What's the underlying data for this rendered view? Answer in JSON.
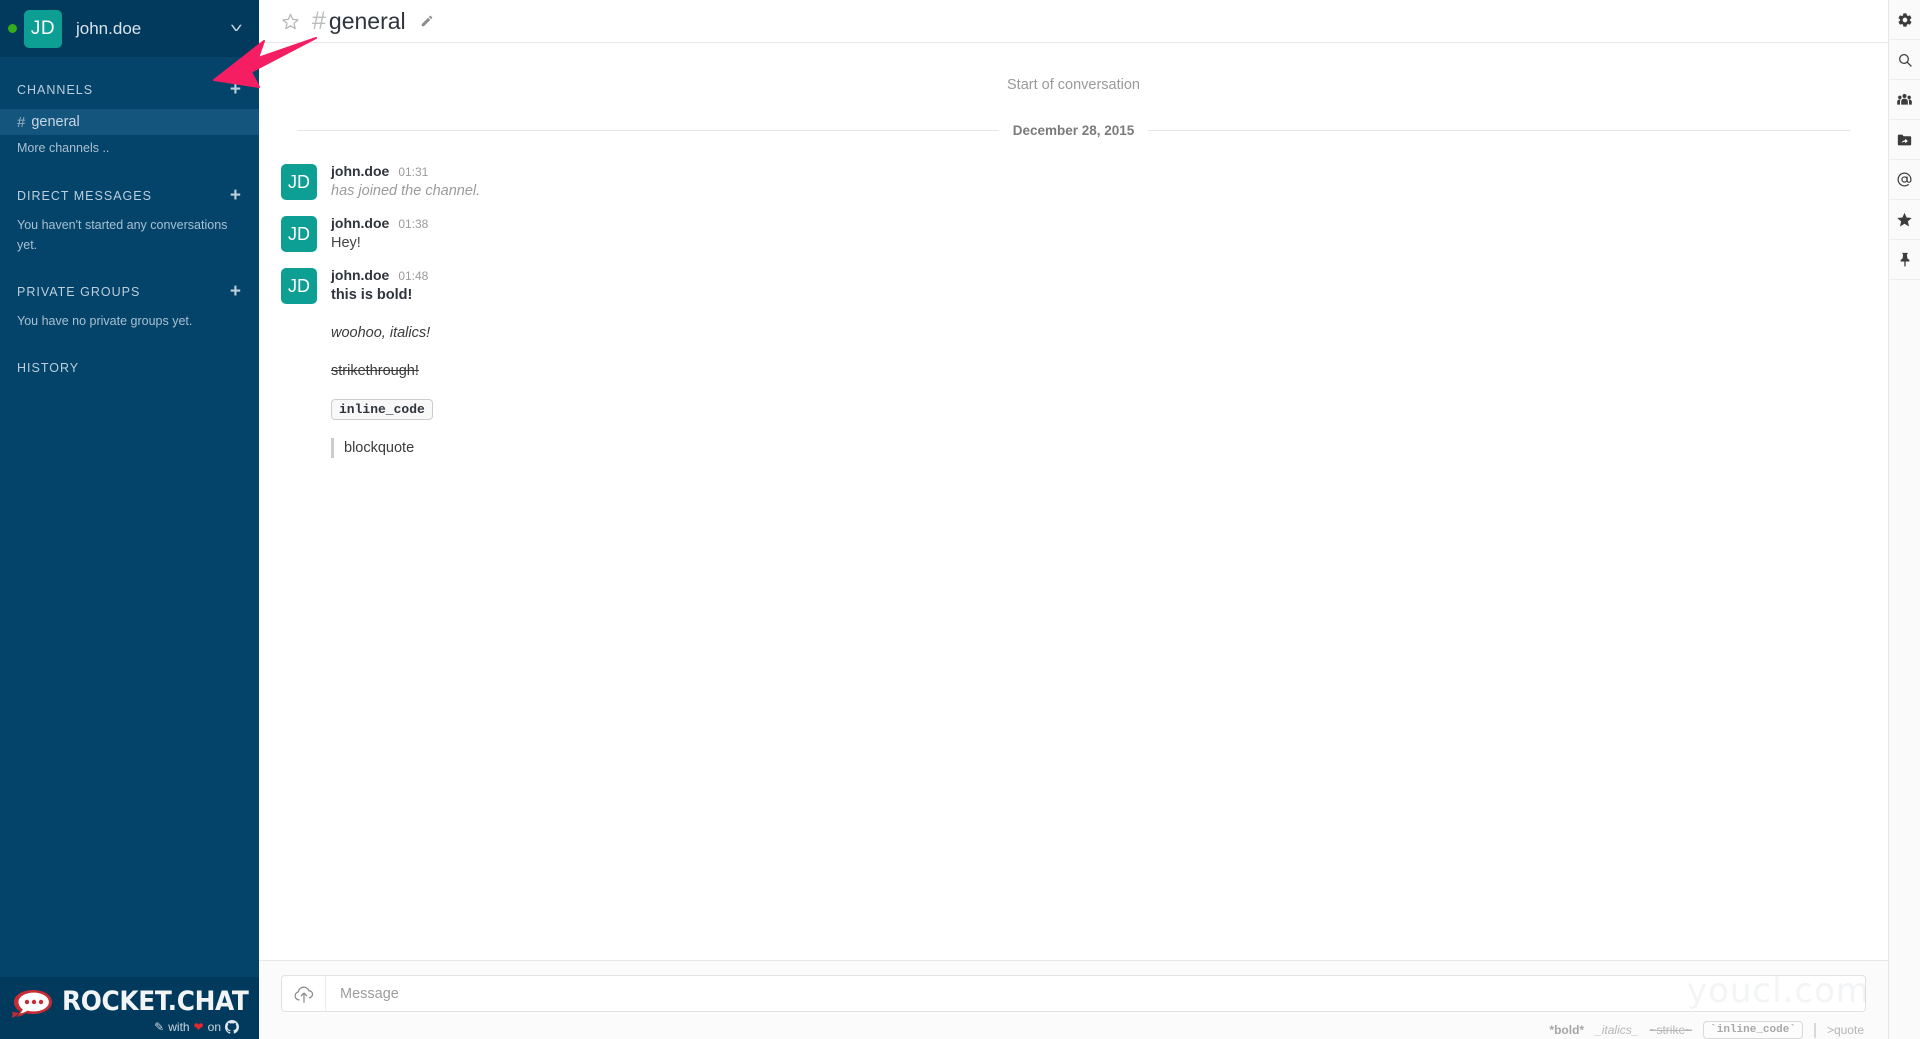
{
  "sidebar": {
    "account": {
      "initials": "JD",
      "username": "john.doe",
      "status": "online",
      "status_color": "#35ac19",
      "avatar_color": "#0d9f94",
      "chevron_icon": "chevron-down-icon"
    },
    "sections": [
      {
        "title": "CHANNELS",
        "add_icon": "plus-icon",
        "items": [
          {
            "hash": "#",
            "label": "general",
            "active": true
          }
        ],
        "more_label": "More channels ..",
        "empty_label": ""
      },
      {
        "title": "DIRECT MESSAGES",
        "add_icon": "plus-icon",
        "items": [],
        "more_label": "",
        "empty_label": "You haven't started any conversations yet."
      },
      {
        "title": "PRIVATE GROUPS",
        "add_icon": "plus-icon",
        "items": [],
        "more_label": "",
        "empty_label": "You have no private groups yet."
      },
      {
        "title": "HISTORY",
        "add_icon": "",
        "items": [],
        "more_label": "",
        "empty_label": ""
      }
    ],
    "footer": {
      "logo_word": "ROCKET.CHAT",
      "tagline_with": "with",
      "tagline_on": "on",
      "pencil_icon": "pencil-icon",
      "heart_icon": "heart-icon",
      "github_icon": "github-icon",
      "brand_color": "#e8262d"
    },
    "background_color": "#04436a",
    "active_item_color": "#13557d"
  },
  "header": {
    "star_icon": "star-outline-icon",
    "hash": "#",
    "channel_name": "general",
    "edit_icon": "pencil-edit-icon"
  },
  "messages_pane": {
    "start_of_conversation": "Start of conversation",
    "date_divider": "December 28, 2015",
    "messages": [
      {
        "initials": "JD",
        "username": "john.doe",
        "time": "01:31",
        "lines": [
          {
            "type": "system",
            "text": "has joined the channel."
          }
        ]
      },
      {
        "initials": "JD",
        "username": "john.doe",
        "time": "01:38",
        "lines": [
          {
            "type": "plain",
            "text": "Hey!"
          }
        ]
      },
      {
        "initials": "JD",
        "username": "john.doe",
        "time": "01:48",
        "lines": [
          {
            "type": "bold",
            "text": "this is bold!"
          },
          {
            "type": "italic",
            "text": "woohoo, italics!"
          },
          {
            "type": "strike",
            "text": "strikethrough!"
          },
          {
            "type": "code",
            "text": "inline_code"
          },
          {
            "type": "quote",
            "text": "blockquote"
          }
        ]
      }
    ]
  },
  "composer": {
    "upload_icon": "cloud-upload-icon",
    "placeholder": "Message",
    "value": "",
    "format_hints": {
      "bold": "*bold*",
      "italics": "_italics_",
      "strike": "~strike~",
      "code": "`inline_code`",
      "quote": ">quote"
    }
  },
  "rail": {
    "buttons": [
      {
        "icon": "gear-icon",
        "label": "Administration"
      },
      {
        "icon": "search-icon",
        "label": "Search"
      },
      {
        "icon": "users-icon",
        "label": "Members List"
      },
      {
        "icon": "file-share-icon",
        "label": "Uploaded Files"
      },
      {
        "icon": "at-mention-icon",
        "label": "Mentions"
      },
      {
        "icon": "star-icon",
        "label": "Starred Messages"
      },
      {
        "icon": "pin-icon",
        "label": "Pinned Messages"
      }
    ]
  },
  "annotations": {
    "arrow": {
      "name": "pink-arrow-annotation",
      "color": "#f51e63",
      "points_to": "add-channel-button"
    },
    "watermark": "youcl.com"
  }
}
